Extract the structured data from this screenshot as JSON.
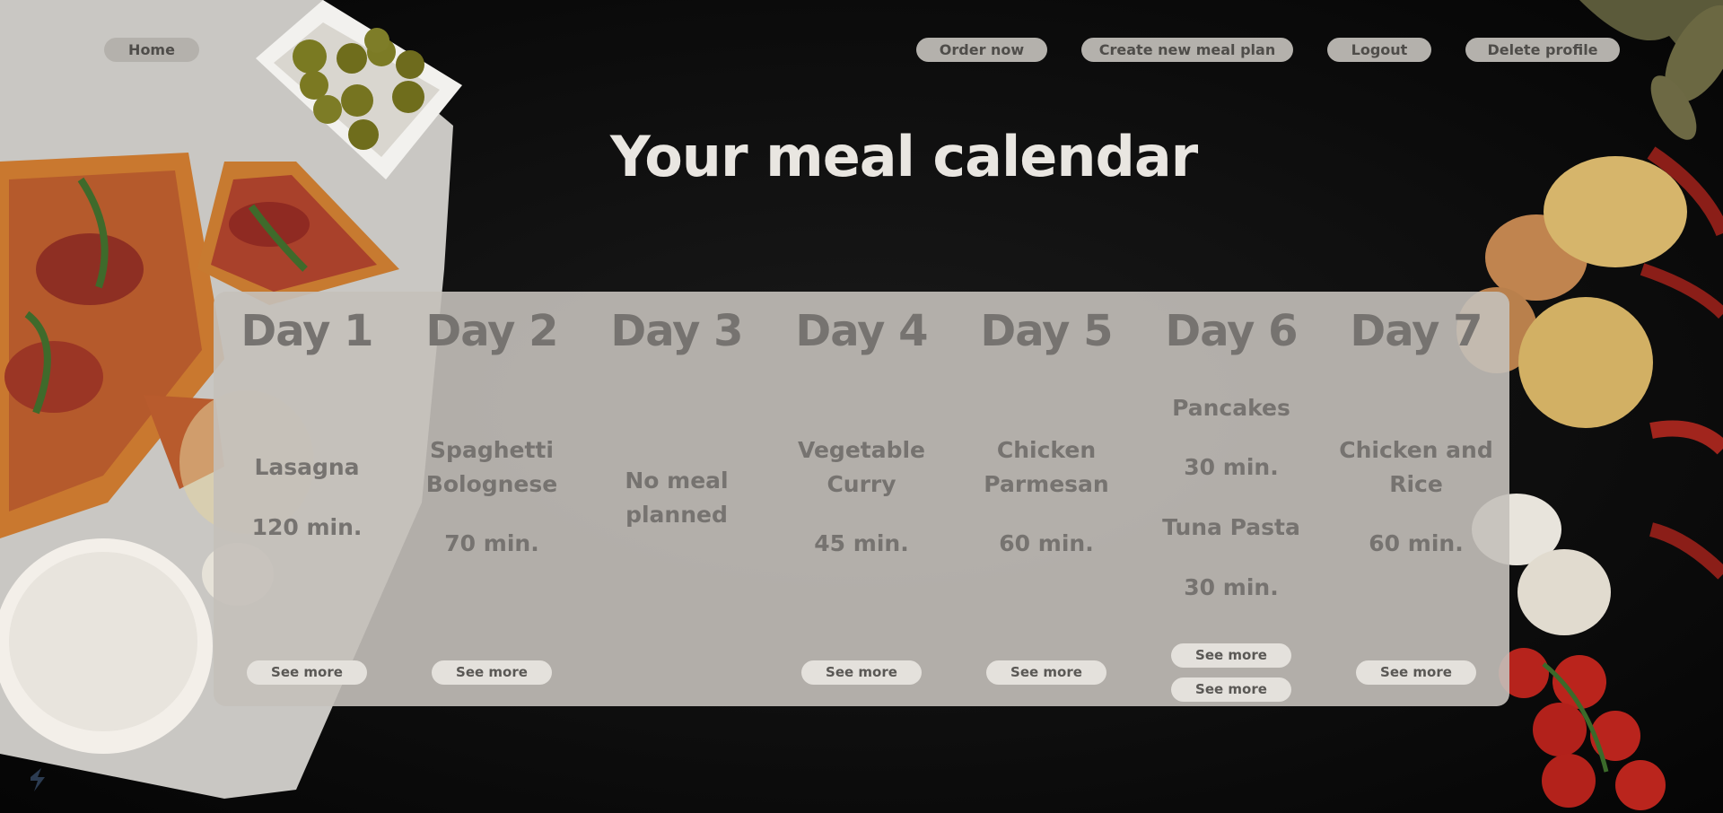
{
  "nav": {
    "home": "Home",
    "order_now": "Order now",
    "create_meal_plan": "Create new meal plan",
    "logout": "Logout",
    "delete_profile": "Delete profile"
  },
  "page_title": "Your meal calendar",
  "see_more_label": "See more",
  "days": [
    {
      "label": "Day 1",
      "meals": [
        {
          "name": "Lasagna",
          "time": "120 min."
        }
      ]
    },
    {
      "label": "Day 2",
      "meals": [
        {
          "name": "Spaghetti Bolognese",
          "time": "70 min."
        }
      ]
    },
    {
      "label": "Day 3",
      "meals": [],
      "empty_text": "No meal planned"
    },
    {
      "label": "Day 4",
      "meals": [
        {
          "name": "Vegetable Curry",
          "time": "45 min."
        }
      ]
    },
    {
      "label": "Day 5",
      "meals": [
        {
          "name": "Chicken Parmesan",
          "time": "60 min."
        }
      ]
    },
    {
      "label": "Day 6",
      "meals": [
        {
          "name": "Pancakes",
          "time": "30 min."
        },
        {
          "name": "Tuna Pasta",
          "time": "30 min."
        }
      ]
    },
    {
      "label": "Day 7",
      "meals": [
        {
          "name": "Chicken and Rice",
          "time": "60 min."
        }
      ]
    }
  ],
  "colors": {
    "background": "#111111",
    "panel": "#c4c0ba",
    "button": "#b4b1ac",
    "title": "#e9e6e1",
    "day_text": "#767370"
  }
}
